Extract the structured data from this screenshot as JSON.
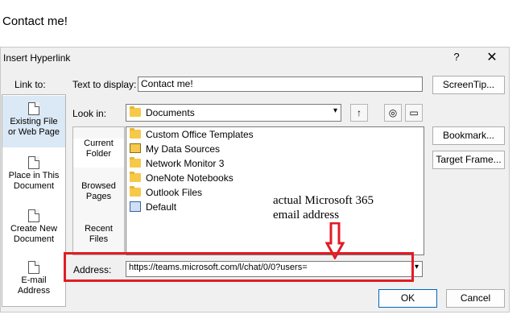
{
  "document": {
    "text": "Contact me!"
  },
  "dialog": {
    "title": "Insert Hyperlink",
    "help_label": "?",
    "close_label": "✕",
    "link_to_label": "Link to:",
    "link_to_items": [
      {
        "label": "Existing File or Web Page",
        "line1": "Existing File",
        "line2": "or Web Page",
        "selected": true
      },
      {
        "label": "Place in This Document",
        "line1": "Place in This",
        "line2": "Document",
        "selected": false
      },
      {
        "label": "Create New Document",
        "line1": "Create New",
        "line2": "Document",
        "selected": false
      },
      {
        "label": "E-mail Address",
        "line1": "E-mail",
        "line2": "Address",
        "selected": false
      }
    ],
    "text_to_display_label": "Text to display:",
    "text_to_display_value": "Contact me!",
    "screentip_label": "ScreenTip...",
    "look_in_label": "Look in:",
    "look_in_value": "Documents",
    "tabs": [
      {
        "line1": "Current",
        "line2": "Folder",
        "selected": true
      },
      {
        "line1": "Browsed",
        "line2": "Pages",
        "selected": false
      },
      {
        "line1": "Recent",
        "line2": "Files",
        "selected": false
      }
    ],
    "files": [
      {
        "name": "Custom Office Templates",
        "icon": "folder-icon"
      },
      {
        "name": "My Data Sources",
        "icon": "data-source-folder-icon"
      },
      {
        "name": "Network Monitor 3",
        "icon": "folder-icon"
      },
      {
        "name": "OneNote Notebooks",
        "icon": "folder-icon"
      },
      {
        "name": "Outlook Files",
        "icon": "folder-icon"
      },
      {
        "name": "Default",
        "icon": "default-file-icon"
      }
    ],
    "bookmark_label": "Bookmark...",
    "target_frame_label": "Target Frame...",
    "address_label": "Address:",
    "address_value": "https://teams.microsoft.com/l/chat/0/0?users=",
    "ok_label": "OK",
    "cancel_label": "Cancel"
  },
  "annotation": {
    "line1": "actual Microsoft 365",
    "line2": "email address",
    "color": "#e01d25"
  }
}
